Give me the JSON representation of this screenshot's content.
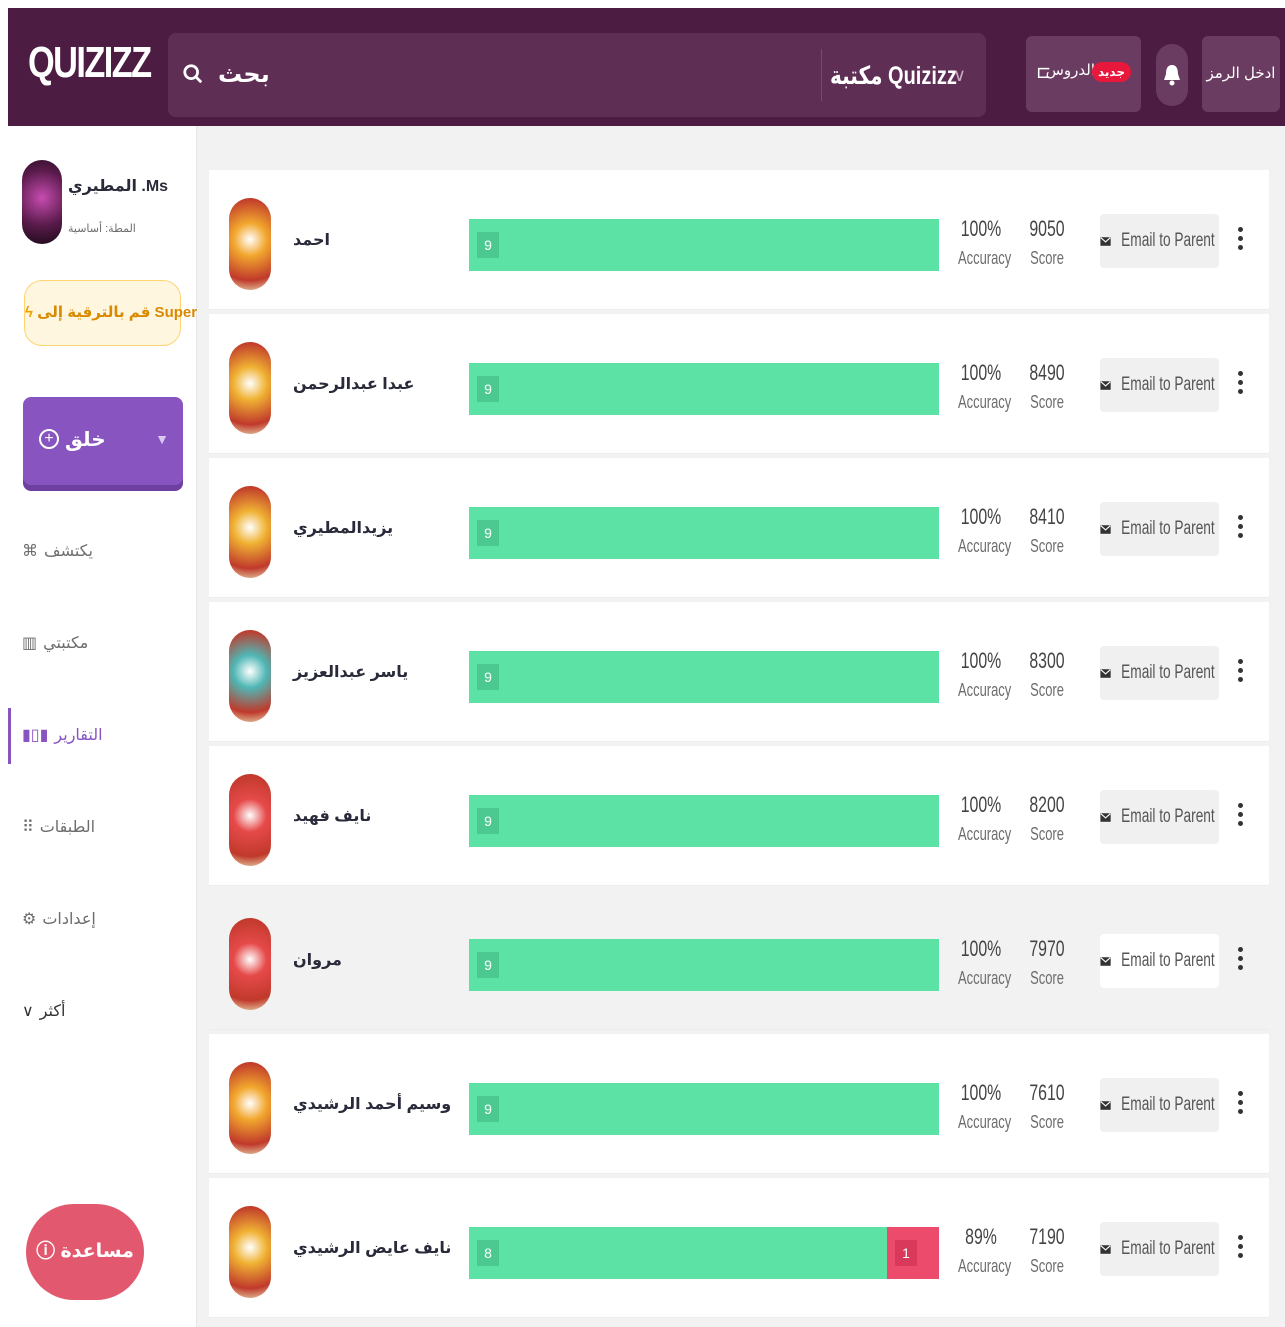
{
  "header": {
    "logo": "QUIZIZZ",
    "search_placeholder": "بحث",
    "library_select": "مكتبة Quizizz",
    "lessons_label": "الدروس",
    "new_badge": "جديد",
    "enter_code": "ادخل الرمز",
    "colors": {
      "bar": "#4c1c43",
      "accent": "#8854c0"
    }
  },
  "sidebar": {
    "profile_name": "المطيري .Ms",
    "profile_role": "المطة: أساسية",
    "upgrade_label": "قم بالترقية إلى Super",
    "create_label": "خلق",
    "nav": [
      {
        "label": "يكتشف",
        "icon": "compass-icon"
      },
      {
        "label": "مكتبتي",
        "icon": "library-icon"
      },
      {
        "label": "التقارير",
        "icon": "reports-icon"
      },
      {
        "label": "الطبقات",
        "icon": "classes-icon"
      },
      {
        "label": "إعدادات",
        "icon": "gear-icon"
      },
      {
        "label": "أكثر",
        "icon": "chevron-down-icon"
      }
    ],
    "help_label": "مساعدة"
  },
  "rows": [
    {
      "name": "احمد",
      "correct": 9,
      "incorrect": 0,
      "accuracy": "100%",
      "score": "9050",
      "avatar_color": "#f2a72e"
    },
    {
      "name": "عبدا عبدالرحمن",
      "correct": 9,
      "incorrect": 0,
      "accuracy": "100%",
      "score": "8490",
      "avatar_color": "#f0b233"
    },
    {
      "name": "يزيدالمطيري",
      "correct": 9,
      "incorrect": 0,
      "accuracy": "100%",
      "score": "8410",
      "avatar_color": "#f0b233"
    },
    {
      "name": "ياسر عبدالعزيز",
      "correct": 9,
      "incorrect": 0,
      "accuracy": "100%",
      "score": "8300",
      "avatar_color": "#4fb7b5"
    },
    {
      "name": "نايف فهيد",
      "correct": 9,
      "incorrect": 0,
      "accuracy": "100%",
      "score": "8200",
      "avatar_color": "#e64a4a"
    },
    {
      "name": "مروان",
      "correct": 9,
      "incorrect": 0,
      "accuracy": "100%",
      "score": "7970",
      "avatar_color": "#e64a4a"
    },
    {
      "name": "وسيم أحمد الرشيدي",
      "correct": 9,
      "incorrect": 0,
      "accuracy": "100%",
      "score": "7610",
      "avatar_color": "#f2a72e"
    },
    {
      "name": "نايف عايض الرشيدي",
      "correct": 8,
      "incorrect": 1,
      "accuracy": "89%",
      "score": "7190",
      "avatar_color": "#f0b233"
    }
  ],
  "labels": {
    "accuracy": "Accuracy",
    "score": "Score",
    "email_parent": "Email to Parent"
  },
  "highlighted_row": 5
}
